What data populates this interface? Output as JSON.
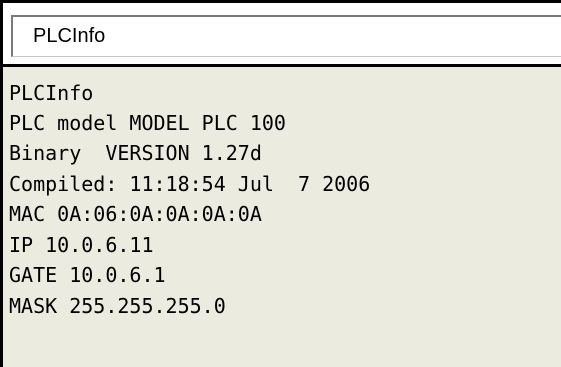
{
  "command_bar": {
    "value": "PLCInfo"
  },
  "output": {
    "lines": [
      "PLCInfo",
      "PLC model MODEL PLC 100",
      "Binary  VERSION 1.27d",
      "Compiled: 11:18:54 Jul  7 2006",
      "MAC 0A:06:0A:0A:0A:0A",
      "IP 10.0.6.11",
      "GATE 10.0.6.1",
      "MASK 255.255.255.0"
    ]
  }
}
